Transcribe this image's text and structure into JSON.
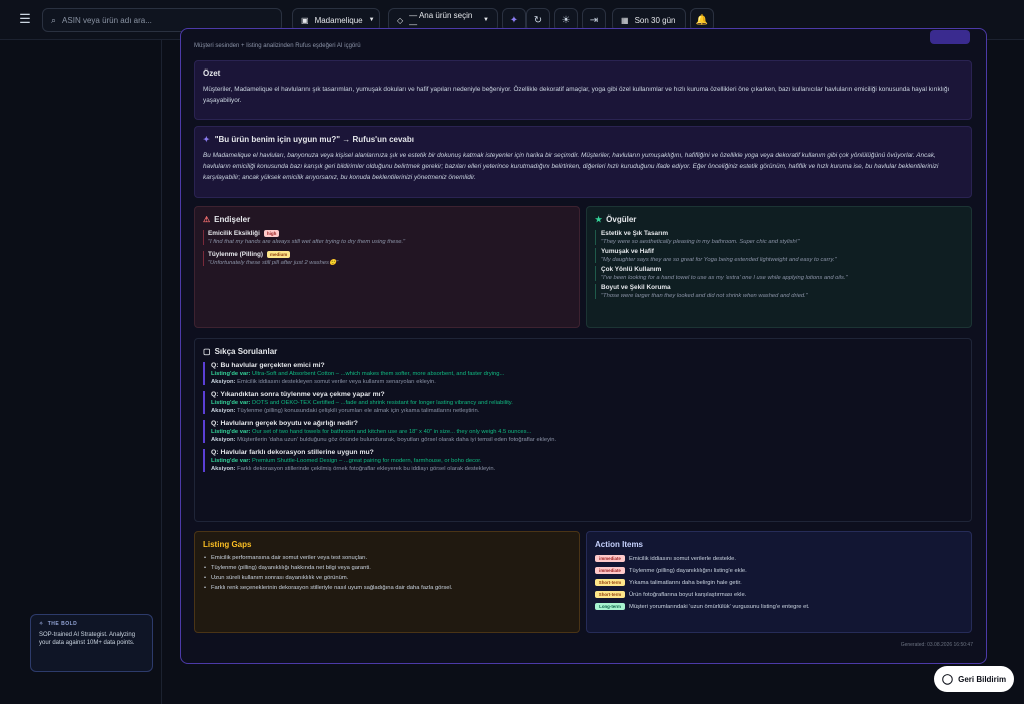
{
  "topbar": {
    "search_placeholder": "ASIN veya ürün adı ara...",
    "store": "Madamelique",
    "product": "— Ana ürün seçin —",
    "date_range": "Son 30 gün"
  },
  "subtitle": "Müşteri sesinden + listing analizinden Rufus eşdeğeri AI içgörü",
  "summary": {
    "title": "Özet",
    "text": "Müşteriler, Madamelique el havlularını şık tasarımları, yumuşak dokuları ve hafif yapıları nedeniyle beğeniyor. Özellikle dekoratif amaçlar, yoga gibi özel kullanımlar ve hızlı kuruma özellikleri öne çıkarken, bazı kullanıcılar havluların emiciliği konusunda hayal kırıklığı yaşayabiliyor."
  },
  "rufus": {
    "title": "\"Bu ürün benim için uygun mu?\" → Rufus'un cevabı",
    "text": "Bu Madamelique el havluları, banyonuza veya kişisel alanlarınıza şık ve estetik bir dokunuş katmak isteyenler için harika bir seçimdir. Müşteriler, havluların yumuşaklığını, hafifliğini ve özellikle yoga veya dekoratif kullanım gibi çok yönlülüğünü övüyorlar. Ancak, havluların emiciliği konusunda bazı karışık geri bildirimler olduğunu belirtmek gerekir; bazıları elleri yeterince kurutmadığını belirtirken, diğerleri hızlı kuruduğunu ifade ediyor. Eğer önceliğiniz estetik görünüm, hafiflik ve hızlı kuruma ise, bu havlular beklentilerinizi karşılayabilir; ancak yüksek emicilik arıyorsanız, bu konuda beklentilerinizi yönetmeniz önemlidir."
  },
  "concerns": {
    "title": "Endişeler",
    "items": [
      {
        "label": "Emicilik Eksikliği",
        "badge": "high",
        "quote": "\"I find that my hands are always still wet after trying to dry them using these.\""
      },
      {
        "label": "Tüylenme (Pilling)",
        "badge": "medium",
        "quote": "\"Unfortunately these still pill after just 2 washes🙂\""
      }
    ]
  },
  "praises": {
    "title": "Övgüler",
    "items": [
      {
        "label": "Estetik ve Şık Tasarım",
        "quote": "\"They were so aesthetically pleasing in my bathroom. Super chic and stylish!\""
      },
      {
        "label": "Yumuşak ve Hafif",
        "quote": "\"My daughter says they are so great for Yoga being extended lightweight and easy to carry.\""
      },
      {
        "label": "Çok Yönlü Kullanım",
        "quote": "\"I've been looking for a hand towel to use as my 'extra' one I use while applying lotions and oils.\""
      },
      {
        "label": "Boyut ve Şekil Koruma",
        "quote": "\"Those were larger than they looked and did not shrink when washed and dried.\""
      }
    ]
  },
  "faq": {
    "title": "Sıkça Sorulanlar",
    "listing_label": "Listing'de var:",
    "action_label": "Aksiyon:",
    "items": [
      {
        "q": "Q: Bu havlular gerçekten emici mi?",
        "listing": "Ultra-Soft and Absorbent Cotton – ...which makes them softer, more absorbent, and faster drying...",
        "action": "Emicilik iddiasını destekleyen somut veriler veya kullanım senaryoları ekleyin."
      },
      {
        "q": "Q: Yıkandıktan sonra tüylenme veya çekme yapar mı?",
        "listing": "DOTS and OEKO-TEX Certified – ...fade and shrink resistant for longer lasting vibrancy and reliability.",
        "action": "Tüylenme (pilling) konusundaki çelişkili yorumları ele almak için yıkama talimatlarını netleştirin."
      },
      {
        "q": "Q: Havluların gerçek boyutu ve ağırlığı nedir?",
        "listing": "Our set of two hand towels for bathroom and kitchen use are 18\" x 40\" in size... they only weigh 4.5 ounces...",
        "action": "Müşterilerin 'daha uzun' bulduğunu göz önünde bulundurarak, boyutları görsel olarak daha iyi temsil eden fotoğraflar ekleyin."
      },
      {
        "q": "Q: Havlular farklı dekorasyon stillerine uygun mu?",
        "listing": "Premium Shuttle-Loomed Design – ...great pairing for modern, farmhouse, or boho decor.",
        "action": "Farklı dekorasyon stillerinde çekilmiş örnek fotoğraflar ekleyerek bu iddiayı görsel olarak destekleyin."
      }
    ]
  },
  "gaps": {
    "title": "Listing Gaps",
    "items": [
      "Emicilik performansına dair somut veriler veya test sonuçları.",
      "Tüylenme (pilling) dayanıklılığı hakkında net bilgi veya garanti.",
      "Uzun süreli kullanım sonrası dayanıklılık ve görünüm.",
      "Farklı renk seçeneklerinin dekorasyon stilleriyle nasıl uyum sağladığına dair daha fazla görsel."
    ]
  },
  "actions": {
    "title": "Action Items",
    "items": [
      {
        "badge": "immediate",
        "text": "Emicilik iddiasını somut verilerle destekle."
      },
      {
        "badge": "immediate",
        "text": "Tüylenme (pilling) dayanıklılığını listing'e ekle."
      },
      {
        "badge": "Short-term",
        "text": "Yıkama talimatlarını daha belirgin hale getir."
      },
      {
        "badge": "Short-term",
        "text": "Ürün fotoğraflarına boyut karşılaştırması ekle."
      },
      {
        "badge": "Long-term",
        "text": "Müşteri yorumlarındaki 'uzun ömürlülük' vurgusunu listing'e entegre et."
      }
    ]
  },
  "generated": "Generated: 03.08.2026 16:50:47",
  "promo": {
    "tag": "THE BOLD",
    "text": "SOP-trained AI Strategist. Analyzing your data against 10M+ data points."
  },
  "feedback": "Geri Bildirim",
  "colors": {
    "badge_high": "#fecaca",
    "badge_medium": "#fde68a",
    "immediate": "#fecaca",
    "short_term": "#fde68a",
    "long_term": "#a7f3d0"
  }
}
